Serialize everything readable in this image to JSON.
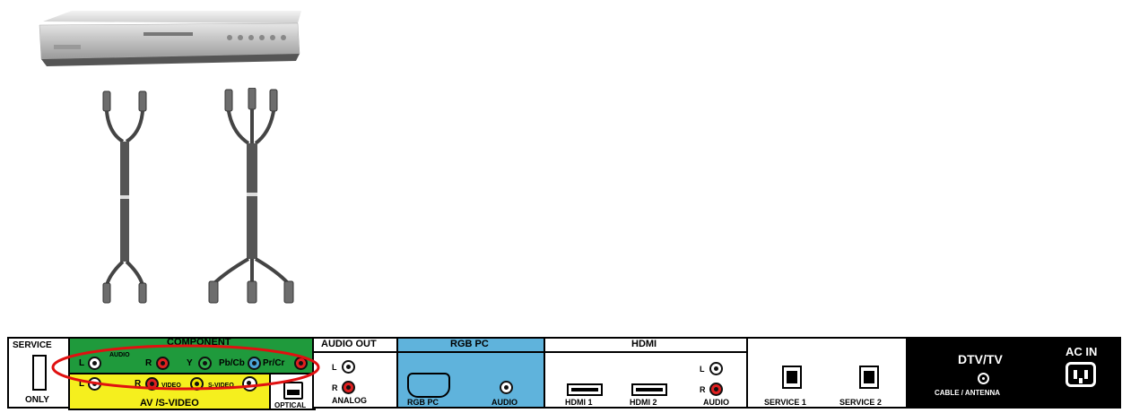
{
  "panel": {
    "service": {
      "top": "SERVICE",
      "bottom": "ONLY"
    },
    "component": {
      "title": "COMPONENT",
      "audio_label": "AUDIO",
      "l": "L",
      "r": "R",
      "y": "Y",
      "pb": "Pb/Cb",
      "pr": "Pr/Cr"
    },
    "av": {
      "l": "L",
      "r": "R",
      "video": "VIDEO",
      "svideo": "S-VIDEO",
      "title": "AV /S-VIDEO"
    },
    "optical": "OPTICAL",
    "audio_out": {
      "title": "AUDIO  OUT",
      "l": "L",
      "r": "R",
      "analog": "ANALOG"
    },
    "rgb": {
      "title": "RGB  PC",
      "pc": "RGB PC",
      "audio": "AUDIO"
    },
    "hdmi": {
      "title": "HDMI",
      "h1": "HDMI 1",
      "h2": "HDMI 2",
      "l": "L",
      "r": "R",
      "audio": "AUDIO"
    },
    "service_ports": {
      "s1": "SERVICE 1",
      "s2": "SERVICE 2"
    },
    "dtv": {
      "title": "DTV/TV",
      "sub": "CABLE / ANTENNA"
    },
    "ac": "AC  IN"
  },
  "colors": {
    "component_green": "#1f9a3c",
    "av_yellow": "#f5ef1e",
    "rgb_blue": "#5fb3dc",
    "highlight_red": "#e01010"
  }
}
